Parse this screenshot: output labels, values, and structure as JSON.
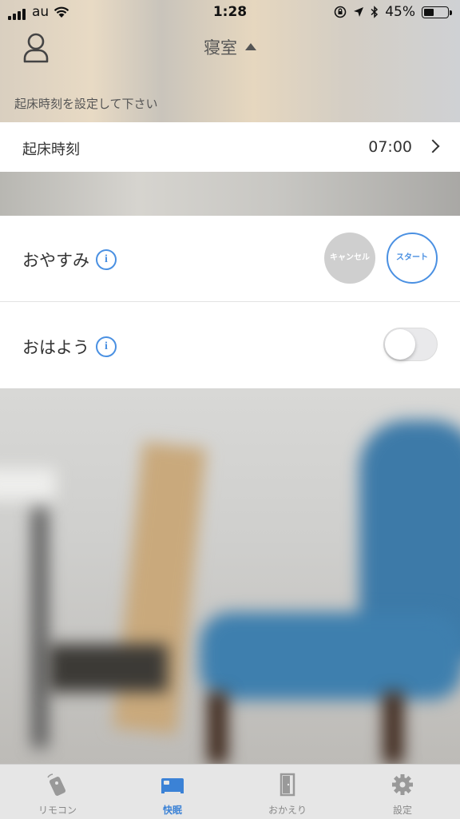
{
  "status_bar": {
    "carrier": "au",
    "time": "1:28",
    "battery_percent": "45%",
    "battery_level": 0.45
  },
  "header": {
    "room_name": "寝室",
    "hint": "起床時刻を設定して下さい"
  },
  "wake_time": {
    "label": "起床時刻",
    "value": "07:00"
  },
  "oyasumi": {
    "label": "おやすみ",
    "cancel_label": "キャンセル",
    "start_label": "スタート"
  },
  "ohayou": {
    "label": "おはよう",
    "toggle_on": false
  },
  "tabs": [
    {
      "label": "リモコン",
      "icon": "remote-icon",
      "active": false
    },
    {
      "label": "快眠",
      "icon": "bed-icon",
      "active": true
    },
    {
      "label": "おかえり",
      "icon": "door-icon",
      "active": false
    },
    {
      "label": "設定",
      "icon": "gear-icon",
      "active": false
    }
  ],
  "colors": {
    "accent": "#4a90e2",
    "tab_active": "#3b82d6",
    "cancel_bg": "#cfcfcf"
  }
}
